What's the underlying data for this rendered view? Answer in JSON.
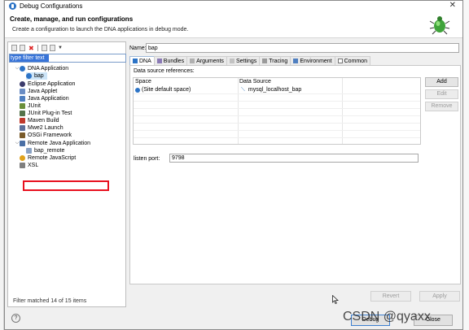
{
  "window": {
    "title": "Debug Configurations",
    "close_glyph": "✕"
  },
  "header": {
    "title": "Create, manage, and run configurations",
    "description": "Create a configuration to launch the DNA applications in debug mode.",
    "icon": "bug-icon"
  },
  "left": {
    "filter_placeholder": "type filter text",
    "tree": [
      {
        "label": "DNA Application",
        "icon": "app-icon",
        "expanded": true,
        "level": 0
      },
      {
        "label": "bap",
        "icon": "config-icon",
        "level": 1,
        "selected": true
      },
      {
        "label": "Eclipse Application",
        "icon": "eclipse-icon",
        "level": 0
      },
      {
        "label": "Java Applet",
        "icon": "applet-icon",
        "level": 0
      },
      {
        "label": "Java Application",
        "icon": "java-app-icon",
        "level": 0
      },
      {
        "label": "JUnit",
        "icon": "junit-icon",
        "level": 0
      },
      {
        "label": "JUnit Plug-in Test",
        "icon": "junit-plugin-icon",
        "level": 0
      },
      {
        "label": "Maven Build",
        "icon": "maven-icon",
        "level": 0
      },
      {
        "label": "Mwe2 Launch",
        "icon": "mwe2-icon",
        "level": 0
      },
      {
        "label": "OSGi Framework",
        "icon": "osgi-icon",
        "level": 0
      },
      {
        "label": "Remote Java Application",
        "icon": "remote-java-icon",
        "expanded": true,
        "level": 0,
        "highlighted": true
      },
      {
        "label": "bap_remote",
        "icon": "config-icon",
        "level": 1
      },
      {
        "label": "Remote JavaScript",
        "icon": "remote-js-icon",
        "level": 0
      },
      {
        "label": "XSL",
        "icon": "xsl-icon",
        "level": 0
      }
    ],
    "status": "Filter matched 14 of 15 items"
  },
  "form": {
    "name_label": "Name:",
    "name_value": "bap",
    "tabs": [
      "DNA",
      "Bundles",
      "Arguments",
      "Settings",
      "Tracing",
      "Environment",
      "Common"
    ],
    "active_tab": "DNA",
    "data_source_label": "Data source references:",
    "table": {
      "columns": [
        "Space",
        "Data Source"
      ],
      "rows": [
        {
          "space": "(Site default space)",
          "data_source": "mysql_localhost_bap"
        }
      ]
    },
    "buttons": {
      "add": "Add",
      "edit": "Edit",
      "remove": "Remove"
    },
    "port_label": "listen port:",
    "port_value": "9798",
    "revert": "Revert",
    "apply": "Apply"
  },
  "footer": {
    "help": "?",
    "debug": "Debug",
    "close": "Close"
  },
  "watermark": "CSDN @qyaxx",
  "colors": {
    "accent": "#3874d8",
    "highlight_box": "#e8101e",
    "selected_row": "#cce4f7"
  }
}
